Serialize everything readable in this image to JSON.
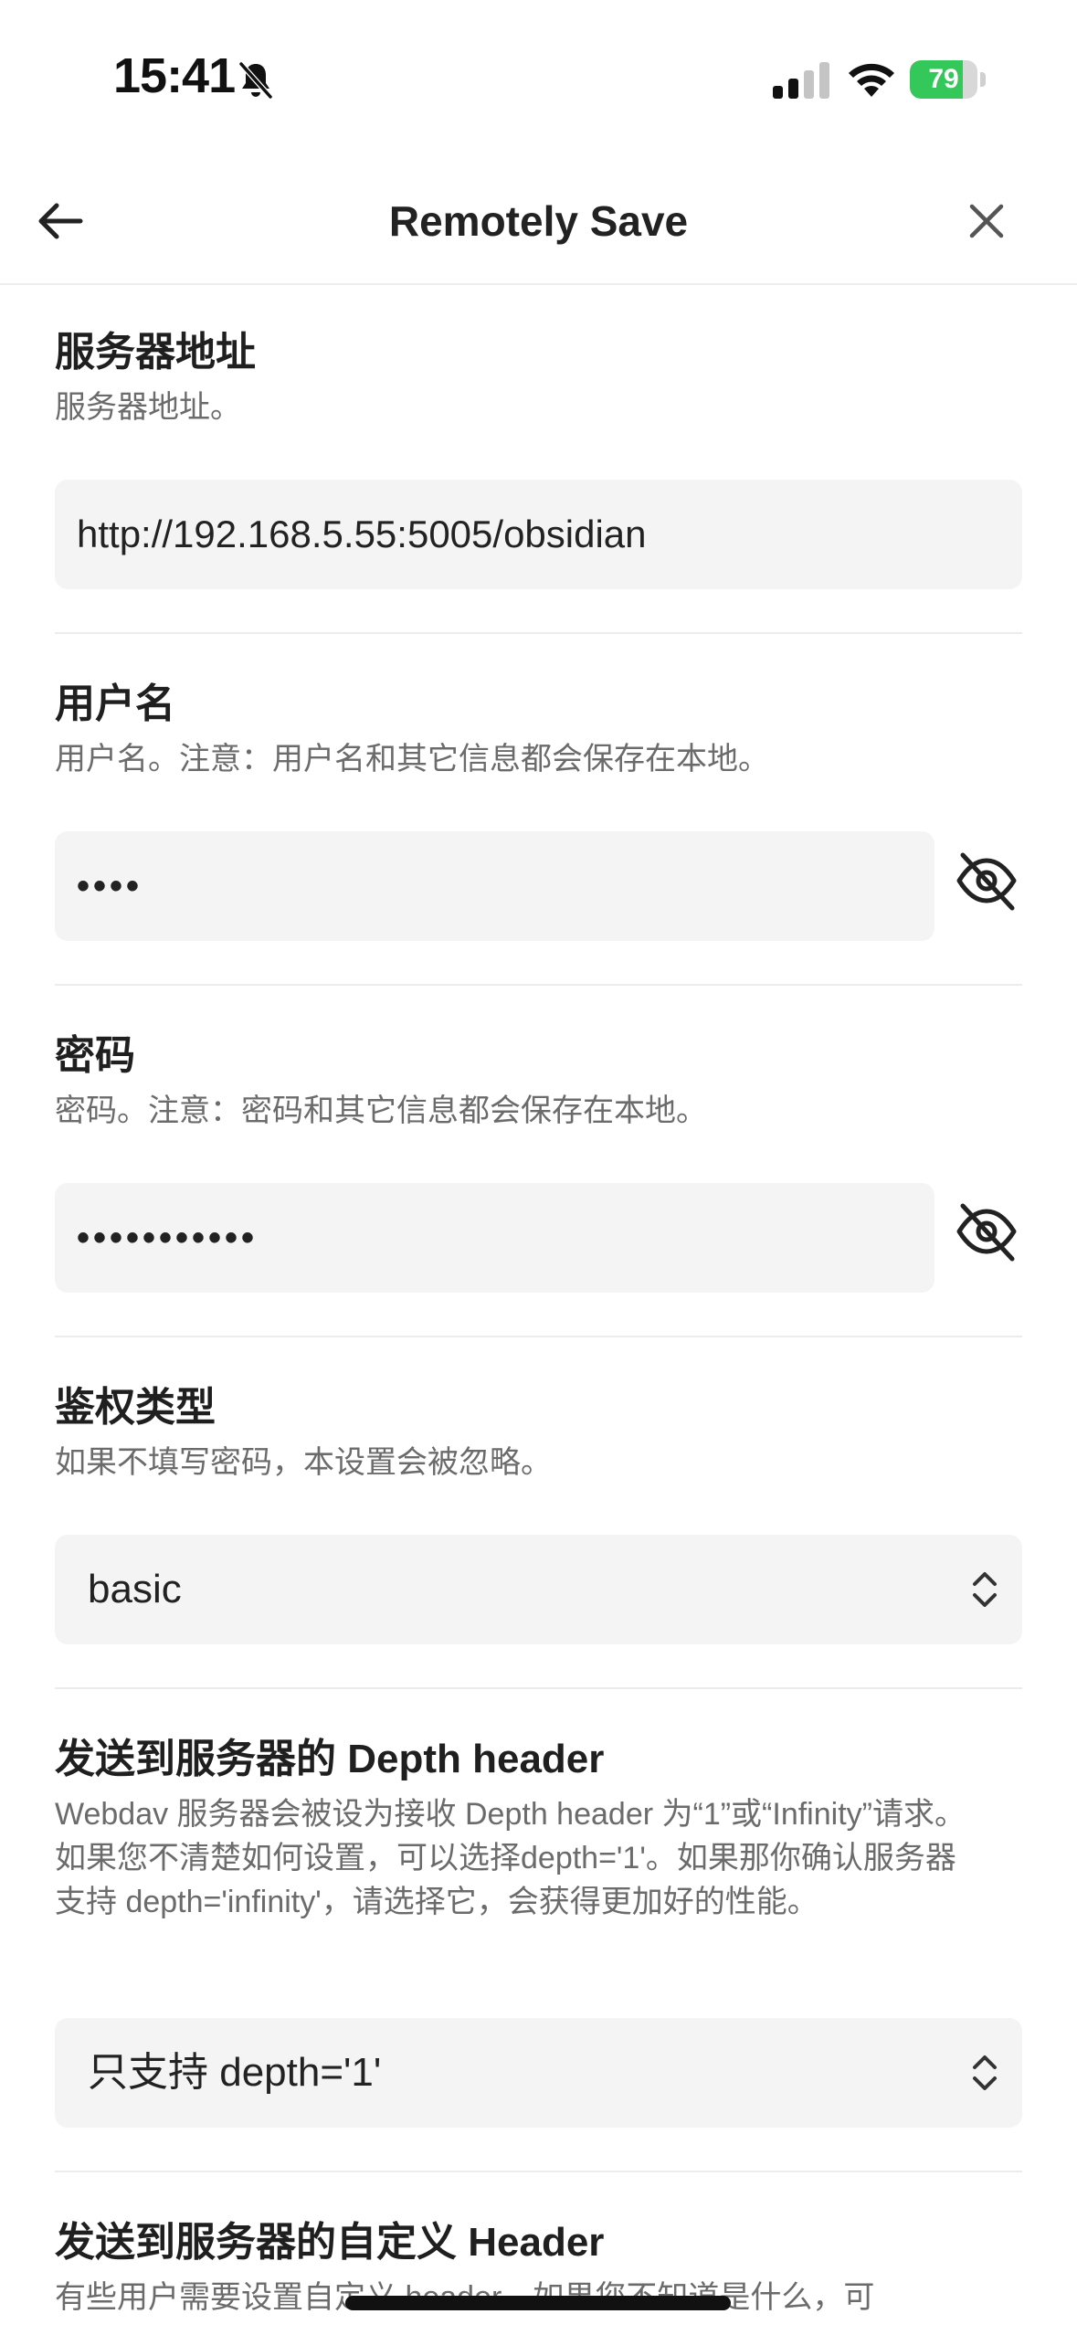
{
  "status_bar": {
    "time": "15:41",
    "battery": "79",
    "battery_level": 0.79
  },
  "header": {
    "title": "Remotely Save"
  },
  "settings": {
    "server": {
      "name": "服务器地址",
      "desc": "服务器地址。",
      "value": "http://192.168.5.55:5005/obsidian"
    },
    "username": {
      "name": "用户名",
      "desc": "用户名。注意：用户名和其它信息都会保存在本地。",
      "value": "••••"
    },
    "password": {
      "name": "密码",
      "desc": "密码。注意：密码和其它信息都会保存在本地。",
      "value": "•••••••••••"
    },
    "auth_type": {
      "name": "鉴权类型",
      "desc": "如果不填写密码，本设置会被忽略。",
      "value": "basic"
    },
    "depth": {
      "name": "发送到服务器的 Depth header",
      "desc": "Webdav 服务器会被设为接收 Depth header 为“1”或“Infinity”请求。如果您不清楚如何设置，可以选择depth='1'。如果那你确认服务器支持 depth='infinity'，请选择它，会获得更加好的性能。",
      "value": "只支持 depth='1'"
    },
    "custom_header": {
      "name": "发送到服务器的自定义 Header",
      "desc": "有些用户需要设置自定义 header。如果您不知道是什么，可"
    }
  }
}
